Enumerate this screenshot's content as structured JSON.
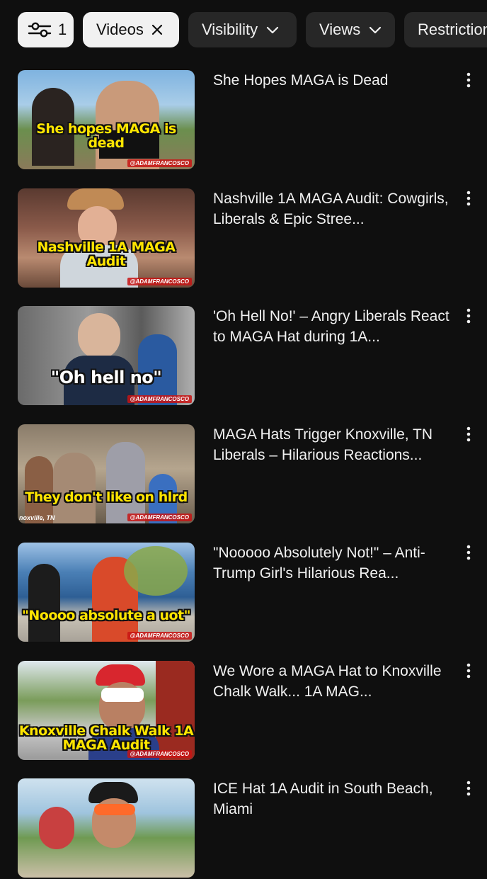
{
  "filters": {
    "filter_count": "1",
    "chips": [
      {
        "label": "Videos",
        "state": "selected"
      },
      {
        "label": "Visibility"
      },
      {
        "label": "Views"
      },
      {
        "label": "Restrictions"
      }
    ]
  },
  "videos": [
    {
      "title": "She Hopes MAGA is Dead",
      "thumb_caption": "She hopes MAGA is dead",
      "watermark": "@ADAMFRANCOSCO"
    },
    {
      "title": "Nashville 1A MAGA Audit: Cowgirls, Liberals & Epic Stree...",
      "thumb_caption": "Nashville 1A MAGA Audit",
      "watermark": "@ADAMFRANCOSCO"
    },
    {
      "title": "'Oh Hell No!' – Angry Liberals React to MAGA Hat during 1A...",
      "thumb_caption": "\"Oh hell no\"",
      "watermark": "@ADAMFRANCOSCO"
    },
    {
      "title": "MAGA Hats Trigger Knoxville, TN Liberals – Hilarious Reactions...",
      "thumb_caption": "They don't like on hlrd",
      "thumb_location": "noxville, TN",
      "watermark": "@ADAMFRANCOSCO"
    },
    {
      "title": "\"Nooooo Absolutely Not!\" – Anti-Trump Girl's Hilarious Rea...",
      "thumb_caption": "\"Noooo absolute a uot\"",
      "watermark": "@ADAMFRANCOSCO"
    },
    {
      "title": "We Wore a MAGA Hat to Knoxville Chalk Walk... 1A MAG...",
      "thumb_caption": "Knoxville Chalk Walk 1A MAGA Audit",
      "watermark": "@ADAMFRANCOSCO"
    },
    {
      "title": "ICE Hat 1A Audit in South Beach, Miami",
      "thumb_caption": "",
      "watermark": ""
    }
  ],
  "colors": {
    "background": "#0f0f0f",
    "chip": "#272727",
    "chip_selected": "#f1f1f1",
    "caption": "#ffe500",
    "text": "#f1f1f1"
  },
  "icons": {
    "filter": "sliders-icon",
    "remove": "close-icon",
    "dropdown": "chevron-down-icon",
    "menu": "more-vert-icon"
  }
}
